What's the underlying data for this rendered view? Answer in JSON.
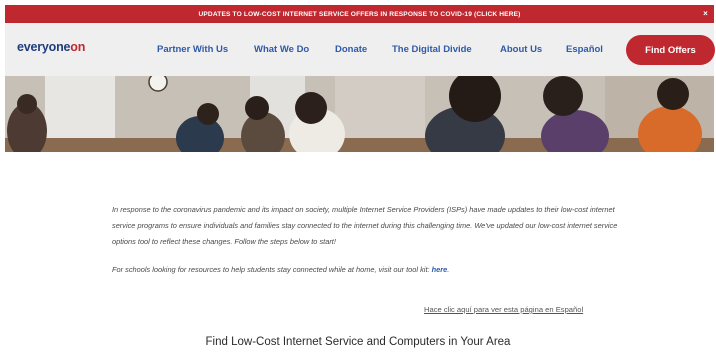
{
  "banner": {
    "text": "UPDATES TO LOW-COST INTERNET SERVICE OFFERS IN RESPONSE TO COVID-19 (CLICK HERE)",
    "close_symbol": "×"
  },
  "header": {
    "logo_part1": "everyone",
    "logo_part2": "on",
    "nav_items": [
      {
        "label": "Partner With Us"
      },
      {
        "label": "What We Do"
      },
      {
        "label": "Donate"
      },
      {
        "label": "The Digital Divide"
      },
      {
        "label": "About Us"
      },
      {
        "label": "Español"
      }
    ],
    "cta_label": "Find Offers"
  },
  "content": {
    "intro_paragraph": "In response to the coronavirus pandemic and its impact on society, multiple Internet Service Providers (ISPs) have made updates to their low-cost internet service programs to ensure individuals and families stay connected to the internet during this challenging time. We've updated our low-cost internet service options tool to reflect these changes. Follow the steps below to start!",
    "schools_text": "For schools looking for resources to help students stay connected while at home, visit our tool kit: ",
    "schools_link": "here",
    "schools_suffix": ".",
    "spanish_link": "Hace clic aquí para ver esta página en Español",
    "section_heading": "Find Low-Cost Internet Service and Computers in Your Area"
  },
  "colors": {
    "brand_red": "#c0282f",
    "brand_blue": "#2f5aa8",
    "logo_blue": "#1f3e7a"
  }
}
